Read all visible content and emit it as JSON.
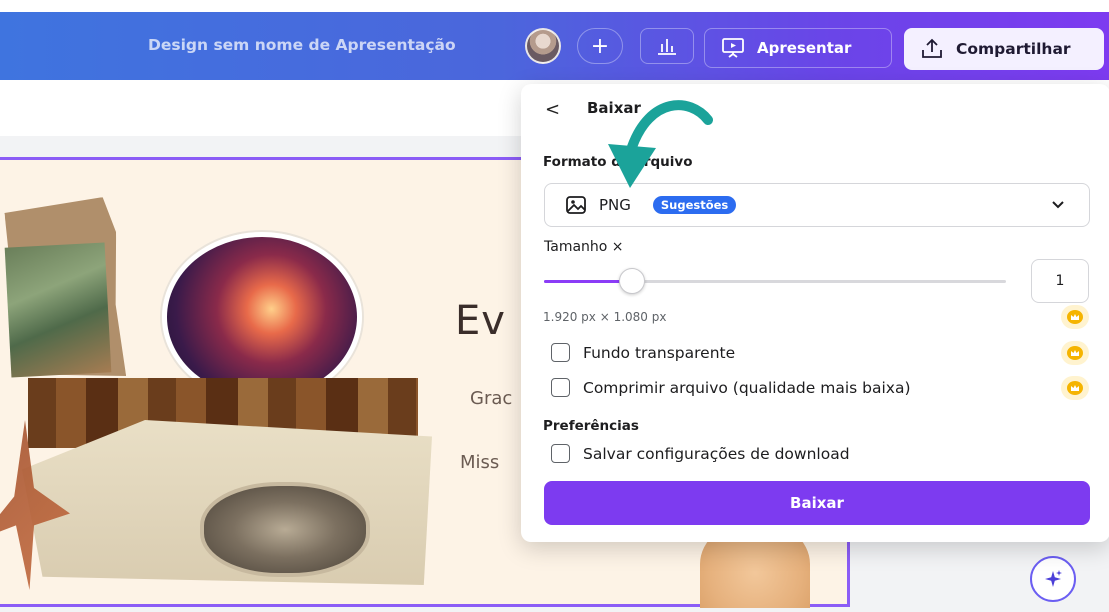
{
  "header": {
    "design_title": "Design sem nome de Apresentação",
    "add_label": "+",
    "present_label": "Apresentar",
    "share_label": "Compartilhar"
  },
  "slide": {
    "title": "Ev",
    "subtitle_1": "Grac",
    "subtitle_2": "Miss"
  },
  "download_panel": {
    "back_label": "<",
    "title": "Baixar",
    "format_label": "Formato de arquivo",
    "format_value": "PNG",
    "format_badge": "Sugestões",
    "size_label": "Tamanho ×",
    "size_value": "1",
    "size_fraction": 0.19,
    "dimensions": "1.920 px × 1.080 px",
    "transparent_label": "Fundo transparente",
    "compress_label": "Comprimir arquivo (qualidade mais baixa)",
    "preferences_label": "Preferências",
    "save_settings_label": "Salvar configurações de download",
    "download_button": "Baixar"
  },
  "colors": {
    "accent": "#7d3bf0",
    "badge": "#2c6cf0",
    "annotation_arrow": "#1ba39a",
    "crown": "#f5b400"
  },
  "icons": [
    "avatar",
    "plus-icon",
    "chart-bars-icon",
    "present-icon",
    "share-upload-icon",
    "image-icon",
    "chevron-down-icon",
    "crown-icon",
    "magic-sparkle-icon",
    "annotation-arrow"
  ]
}
